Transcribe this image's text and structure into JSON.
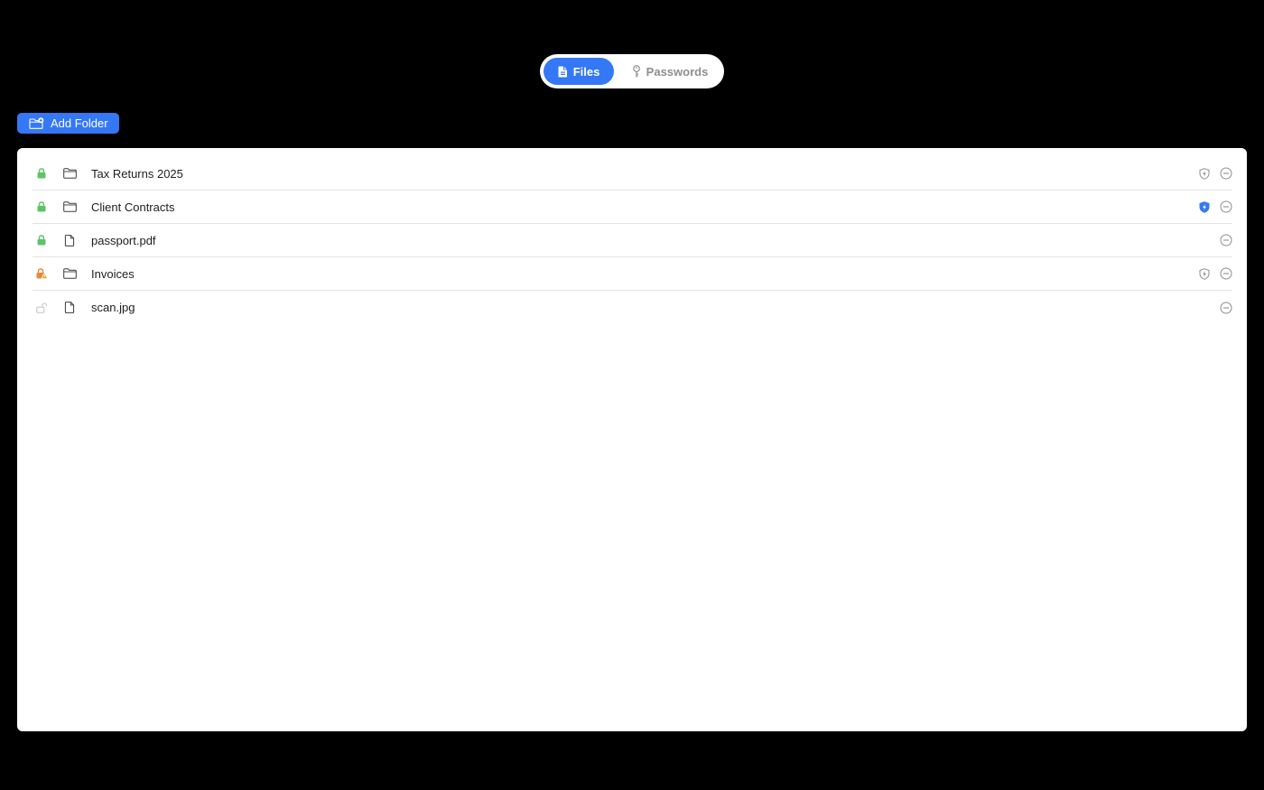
{
  "tabs": [
    {
      "label": "Files",
      "icon": "file-icon",
      "selected": true
    },
    {
      "label": "Passwords",
      "icon": "key-icon",
      "selected": false
    }
  ],
  "toolbar": {
    "add_folder_label": "Add Folder",
    "add_folder_icon": "folder-badge-plus-icon"
  },
  "items": [
    {
      "name": "Tax Returns 2025",
      "type": "folder",
      "lock": "locked",
      "lock_color": "#5dc466",
      "shield": "outline"
    },
    {
      "name": "Client Contracts",
      "type": "folder",
      "lock": "locked",
      "lock_color": "#5dc466",
      "shield": "filled"
    },
    {
      "name": "passport.pdf",
      "type": "file",
      "lock": "locked",
      "lock_color": "#5dc466",
      "shield": "none"
    },
    {
      "name": "Invoices",
      "type": "folder",
      "lock": "warning",
      "lock_color": "#e8893a",
      "shield": "outline"
    },
    {
      "name": "scan.jpg",
      "type": "file",
      "lock": "unlocked",
      "lock_color": "#c7c7cc",
      "shield": "none"
    }
  ],
  "colors": {
    "accent": "#3478f6",
    "background": "#000000",
    "panel": "#ffffff",
    "locked": "#5dc466",
    "warning": "#e8893a",
    "unlocked": "#c7c7cc",
    "icon_gray": "#8e8e93"
  }
}
